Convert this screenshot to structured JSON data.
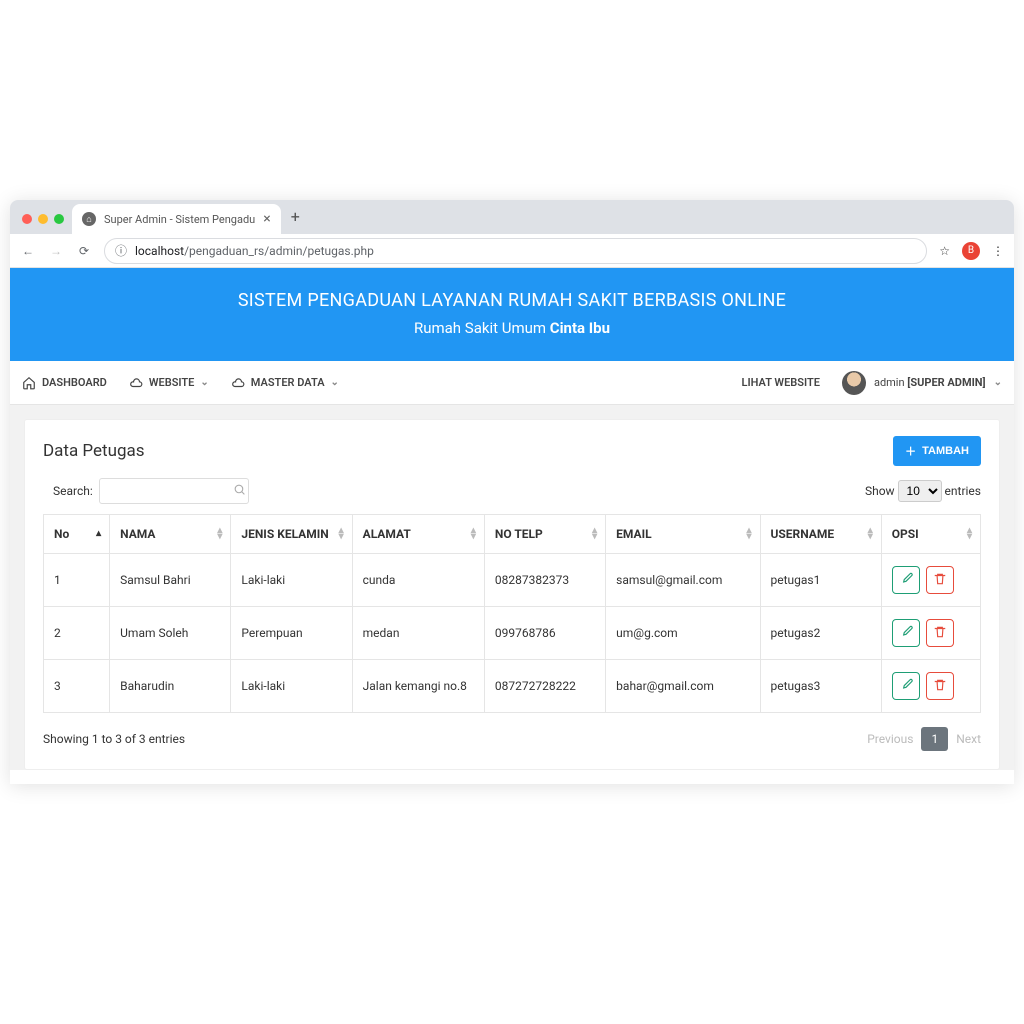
{
  "browser": {
    "tab_title": "Super Admin - Sistem Pengadu",
    "url_host": "localhost",
    "url_path": "/pengaduan_rs/admin/petugas.php",
    "profile_initial": "B"
  },
  "hero": {
    "title": "SISTEM PENGADUAN LAYANAN RUMAH SAKIT BERBASIS ONLINE",
    "subtitle_prefix": "Rumah Sakit Umum ",
    "subtitle_bold": "Cinta Ibu"
  },
  "nav": {
    "dashboard": "DASHBOARD",
    "website": "WEBSITE",
    "master": "MASTER DATA",
    "lihat_website": "LIHAT WEBSITE",
    "user_label": "admin ",
    "user_role": "[SUPER ADMIN]"
  },
  "card": {
    "title": "Data Petugas",
    "add_label": "TAMBAH",
    "search_label": "Search:",
    "show_prefix": "Show",
    "show_value": "10",
    "show_suffix": "entries",
    "info": "Showing 1 to 3 of 3 entries",
    "prev": "Previous",
    "next": "Next",
    "page": "1"
  },
  "columns": {
    "no": "No",
    "nama": "NAMA",
    "jk": "JENIS KELAMIN",
    "alamat": "ALAMAT",
    "telp": "NO TELP",
    "email": "EMAIL",
    "username": "USERNAME",
    "opsi": "OPSI"
  },
  "rows": [
    {
      "no": "1",
      "nama": "Samsul Bahri",
      "jk": "Laki-laki",
      "alamat": "cunda",
      "telp": "08287382373",
      "email": "samsul@gmail.com",
      "username": "petugas1"
    },
    {
      "no": "2",
      "nama": "Umam Soleh",
      "jk": "Perempuan",
      "alamat": "medan",
      "telp": "099768786",
      "email": "um@g.com",
      "username": "petugas2"
    },
    {
      "no": "3",
      "nama": "Baharudin",
      "jk": "Laki-laki",
      "alamat": "Jalan kemangi no.8",
      "telp": "087272728222",
      "email": "bahar@gmail.com",
      "username": "petugas3"
    }
  ]
}
